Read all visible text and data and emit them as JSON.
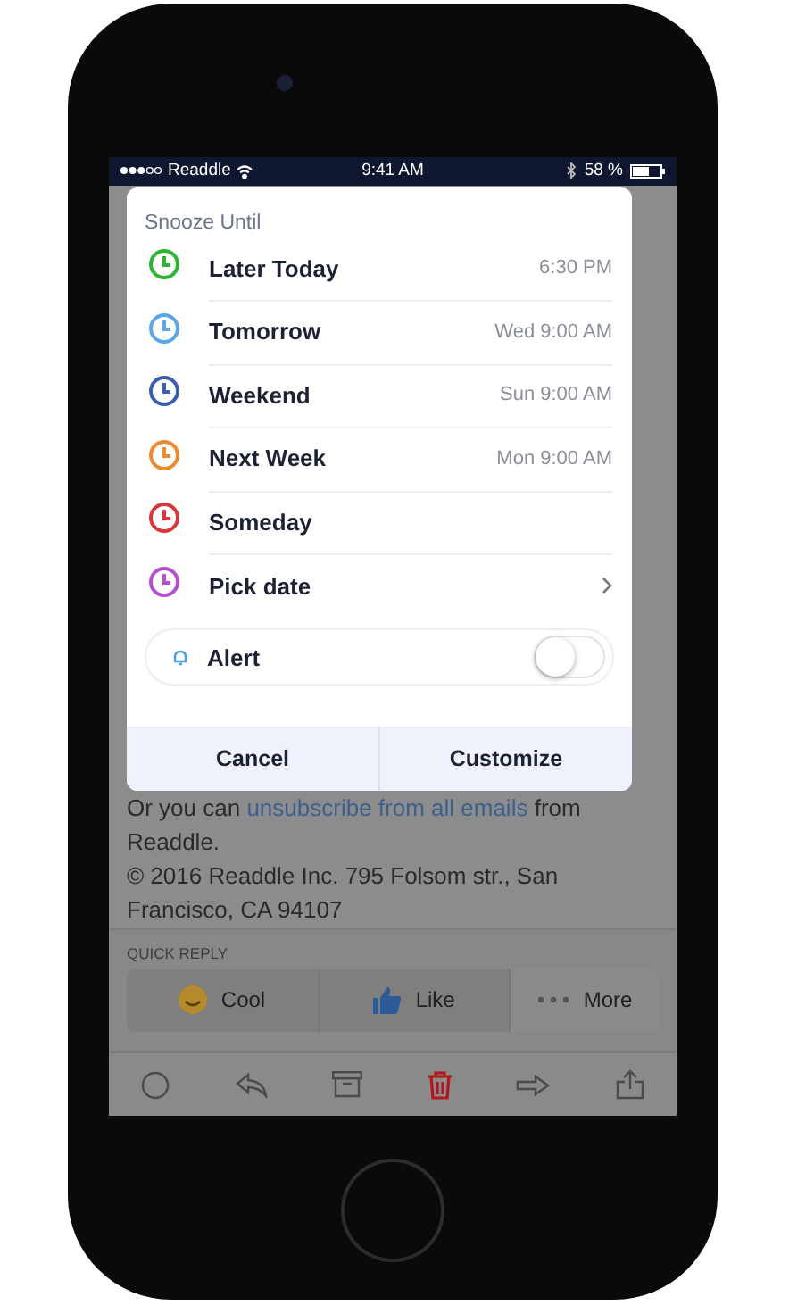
{
  "status_bar": {
    "carrier": "Readdle",
    "time": "9:41 AM",
    "battery": "58 %"
  },
  "dialog": {
    "title": "Snooze Until",
    "options": [
      {
        "label": "Later Today",
        "value": "6:30 PM",
        "color": "#2fb52f",
        "kind": "time"
      },
      {
        "label": "Tomorrow",
        "value": "Wed 9:00 AM",
        "color": "#5aa8e8",
        "kind": "time"
      },
      {
        "label": "Weekend",
        "value": "Sun 9:00 AM",
        "color": "#3a5fb0",
        "kind": "time"
      },
      {
        "label": "Next Week",
        "value": "Mon 9:00 AM",
        "color": "#ee8a2e",
        "kind": "time"
      },
      {
        "label": "Someday",
        "color": "#d9363e",
        "kind": "time"
      },
      {
        "label": "Pick date",
        "color": "#b64fd6",
        "kind": "chevron"
      }
    ],
    "alert": {
      "label": "Alert",
      "on": false
    },
    "buttons": [
      "Cancel",
      "Customize"
    ]
  },
  "email": {
    "before": "Or you can ",
    "link": "unsubscribe from all emails",
    "after": " from Readdle.",
    "footer": "© 2016 Readdle Inc. 795 Folsom str., San Francisco, CA 94107"
  },
  "quick_reply": {
    "title": "QUICK REPLY",
    "buttons": [
      {
        "label": "Cool",
        "kind": "emoji"
      },
      {
        "label": "Like",
        "kind": "thumb"
      },
      {
        "label": "More",
        "kind": "more"
      }
    ]
  }
}
